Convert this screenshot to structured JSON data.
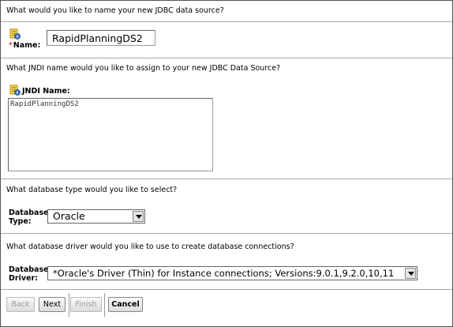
{
  "name_section": {
    "prompt": "What would you like to name your new JDBC data source?",
    "required_marker": "*",
    "label": "Name:",
    "value": "RapidPlanningDS2"
  },
  "jndi_section": {
    "prompt": "What JNDI name would you like to assign to your new JDBC Data Source?",
    "label": "JNDI Name:",
    "value": "RapidPlanningDS2"
  },
  "db_type_section": {
    "prompt": "What database type would you like to select?",
    "label_line1": "Database",
    "label_line2": "Type:",
    "selected": "Oracle"
  },
  "driver_section": {
    "prompt": "What database driver would you like to use to create database connections?",
    "label_line1": "Database",
    "label_line2": "Driver:",
    "selected": "*Oracle's Driver (Thin) for Instance connections; Versions:9.0.1,9.2.0,10,11"
  },
  "buttons": {
    "back": "Back",
    "next": "Next",
    "finish": "Finish",
    "cancel": "Cancel"
  },
  "icon": "field-help-icon"
}
